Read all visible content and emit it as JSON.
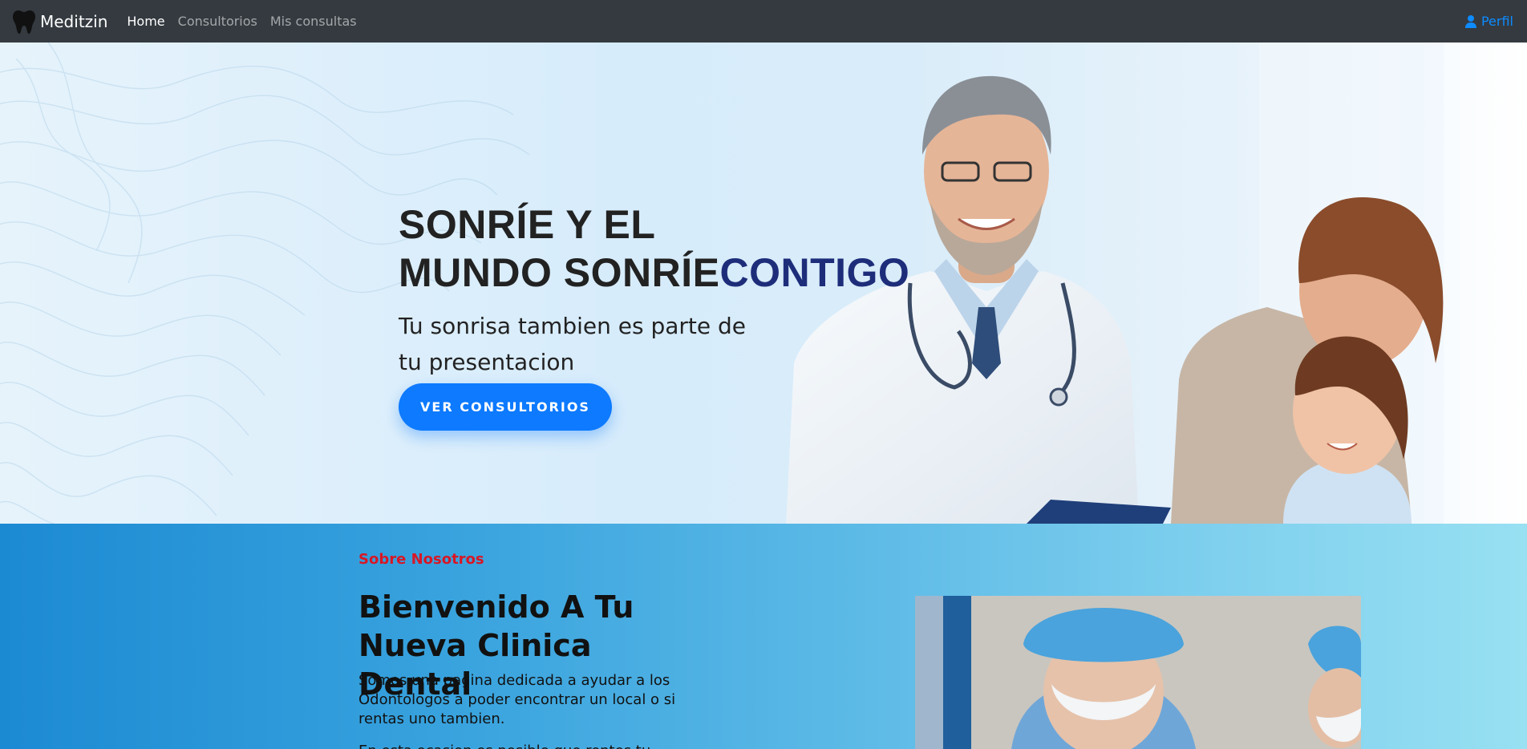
{
  "navbar": {
    "brand": "Meditzin",
    "links": [
      {
        "label": "Home",
        "active": true
      },
      {
        "label": "Consultorios",
        "active": false
      },
      {
        "label": "Mis consultas",
        "active": false
      }
    ],
    "profile_label": "Perfil",
    "icons": {
      "brand": "tooth-icon",
      "profile": "user-icon"
    }
  },
  "hero": {
    "title_line1": "SONRÍE Y EL",
    "title_line2": "MUNDO SONRÍE",
    "title_accent": "CONTIGO",
    "subtitle": "Tu sonrisa tambien es parte de tu presentacion",
    "button_label": "VER CONSULTORIOS"
  },
  "about": {
    "kicker": "Sobre Nosotros",
    "title": "Bienvenido A Tu Nueva Clinica Dental",
    "text": "Somos una pagina dedicada a ayudar a los Odontologos a poder encontrar un local o si rentas uno tambien.",
    "text2": "En esta ocasion es posible que rentes tu"
  },
  "colors": {
    "navbar_bg": "#343a40",
    "primary": "#0d7aff",
    "accent_title": "#1e2d7a",
    "kicker": "#d81726"
  }
}
